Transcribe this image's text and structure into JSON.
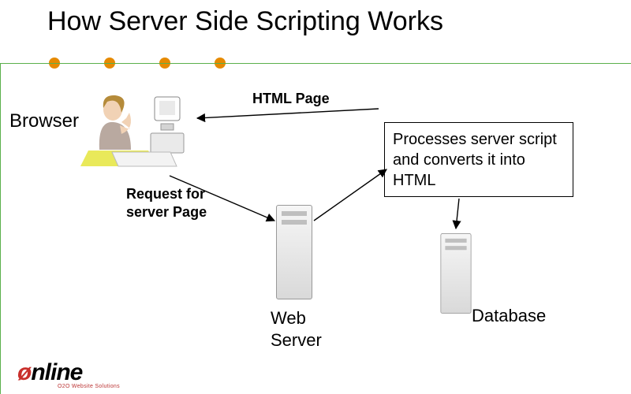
{
  "title": "How Server Side Scripting Works",
  "labels": {
    "browser": "Browser",
    "html_page": "HTML Page",
    "request": "Request for\nserver Page",
    "process": "Processes server script and converts it into HTML",
    "web_server": "Web\nServer",
    "database": "Database"
  },
  "logo": {
    "text": "nline",
    "sub": "O2O Website Solutions"
  },
  "colors": {
    "dot": "#e68a00",
    "rule": "#5bb04c"
  },
  "arrows": [
    {
      "from": "web-server",
      "to": "browser",
      "label": "HTML Page"
    },
    {
      "from": "browser",
      "to": "web-server",
      "label": "Request for server Page"
    },
    {
      "from": "web-server",
      "to": "process-box"
    },
    {
      "from": "process-box",
      "to": "database"
    }
  ]
}
